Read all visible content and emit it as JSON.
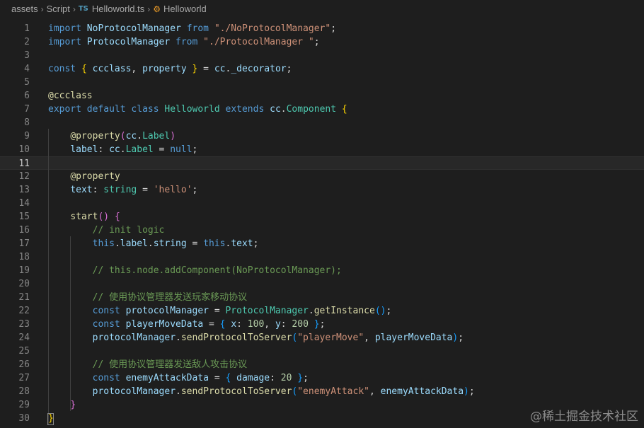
{
  "breadcrumb": {
    "folder1": "assets",
    "folder2": "Script",
    "file_icon": "TS",
    "file": "Helloworld.ts",
    "symbol": "Helloworld"
  },
  "lines": [
    {
      "n": "1",
      "t": [
        [
          "kw",
          "import"
        ],
        [
          "",
          "&nbsp;"
        ],
        [
          "var",
          "NoProtocolManager"
        ],
        [
          "",
          "&nbsp;"
        ],
        [
          "kw",
          "from"
        ],
        [
          "",
          "&nbsp;"
        ],
        [
          "str",
          "\"./NoProtocolManager\""
        ],
        [
          "",
          ";"
        ]
      ]
    },
    {
      "n": "2",
      "t": [
        [
          "kw",
          "import"
        ],
        [
          "",
          "&nbsp;"
        ],
        [
          "var",
          "ProtocolManager"
        ],
        [
          "",
          "&nbsp;"
        ],
        [
          "kw",
          "from"
        ],
        [
          "",
          "&nbsp;"
        ],
        [
          "str",
          "\"./ProtocolManager \""
        ],
        [
          "",
          ";"
        ]
      ]
    },
    {
      "n": "3",
      "t": []
    },
    {
      "n": "4",
      "t": [
        [
          "kw",
          "const"
        ],
        [
          "",
          "&nbsp;"
        ],
        [
          "br1",
          "{"
        ],
        [
          "",
          "&nbsp;"
        ],
        [
          "var",
          "ccclass"
        ],
        [
          "",
          ",&nbsp;"
        ],
        [
          "var",
          "property"
        ],
        [
          "",
          "&nbsp;"
        ],
        [
          "br1",
          "}"
        ],
        [
          "",
          "&nbsp;=&nbsp;"
        ],
        [
          "var",
          "cc"
        ],
        [
          "",
          "."
        ],
        [
          "var",
          "_decorator"
        ],
        [
          "",
          ";"
        ]
      ]
    },
    {
      "n": "5",
      "t": []
    },
    {
      "n": "6",
      "t": [
        [
          "fn",
          "@ccclass"
        ]
      ]
    },
    {
      "n": "7",
      "t": [
        [
          "kw",
          "export"
        ],
        [
          "",
          "&nbsp;"
        ],
        [
          "kw",
          "default"
        ],
        [
          "",
          "&nbsp;"
        ],
        [
          "kw",
          "class"
        ],
        [
          "",
          "&nbsp;"
        ],
        [
          "cls",
          "Helloworld"
        ],
        [
          "",
          "&nbsp;"
        ],
        [
          "kw",
          "extends"
        ],
        [
          "",
          "&nbsp;"
        ],
        [
          "var",
          "cc"
        ],
        [
          "",
          "."
        ],
        [
          "cls",
          "Component"
        ],
        [
          "",
          "&nbsp;"
        ],
        [
          "br1",
          "{"
        ]
      ]
    },
    {
      "n": "8",
      "t": []
    },
    {
      "n": "9",
      "t": [
        [
          "",
          "&nbsp;&nbsp;&nbsp;&nbsp;"
        ],
        [
          "fn",
          "@property"
        ],
        [
          "br2",
          "("
        ],
        [
          "var",
          "cc"
        ],
        [
          "",
          "."
        ],
        [
          "cls",
          "Label"
        ],
        [
          "br2",
          ")"
        ]
      ]
    },
    {
      "n": "10",
      "t": [
        [
          "",
          "&nbsp;&nbsp;&nbsp;&nbsp;"
        ],
        [
          "var",
          "label"
        ],
        [
          "",
          ":&nbsp;"
        ],
        [
          "var",
          "cc"
        ],
        [
          "",
          "."
        ],
        [
          "cls",
          "Label"
        ],
        [
          "",
          "&nbsp;=&nbsp;"
        ],
        [
          "kw",
          "null"
        ],
        [
          "",
          ";"
        ]
      ]
    },
    {
      "n": "11",
      "t": [],
      "current": true
    },
    {
      "n": "12",
      "t": [
        [
          "",
          "&nbsp;&nbsp;&nbsp;&nbsp;"
        ],
        [
          "fn",
          "@property"
        ]
      ]
    },
    {
      "n": "13",
      "t": [
        [
          "",
          "&nbsp;&nbsp;&nbsp;&nbsp;"
        ],
        [
          "var",
          "text"
        ],
        [
          "",
          ":&nbsp;"
        ],
        [
          "cls",
          "string"
        ],
        [
          "",
          "&nbsp;=&nbsp;"
        ],
        [
          "str",
          "'hello'"
        ],
        [
          "",
          ";"
        ]
      ]
    },
    {
      "n": "14",
      "t": []
    },
    {
      "n": "15",
      "t": [
        [
          "",
          "&nbsp;&nbsp;&nbsp;&nbsp;"
        ],
        [
          "fn",
          "start"
        ],
        [
          "br2",
          "()"
        ],
        [
          "",
          "&nbsp;"
        ],
        [
          "br2",
          "{"
        ]
      ]
    },
    {
      "n": "16",
      "t": [
        [
          "",
          "&nbsp;&nbsp;&nbsp;&nbsp;&nbsp;&nbsp;&nbsp;&nbsp;"
        ],
        [
          "cm",
          "// init logic"
        ]
      ]
    },
    {
      "n": "17",
      "t": [
        [
          "",
          "&nbsp;&nbsp;&nbsp;&nbsp;&nbsp;&nbsp;&nbsp;&nbsp;"
        ],
        [
          "kw",
          "this"
        ],
        [
          "",
          "."
        ],
        [
          "var",
          "label"
        ],
        [
          "",
          "."
        ],
        [
          "var",
          "string"
        ],
        [
          "",
          "&nbsp;=&nbsp;"
        ],
        [
          "kw",
          "this"
        ],
        [
          "",
          "."
        ],
        [
          "var",
          "text"
        ],
        [
          "",
          ";"
        ]
      ]
    },
    {
      "n": "18",
      "t": []
    },
    {
      "n": "19",
      "t": [
        [
          "",
          "&nbsp;&nbsp;&nbsp;&nbsp;&nbsp;&nbsp;&nbsp;&nbsp;"
        ],
        [
          "cm",
          "// this.node.addComponent(NoProtocolManager);"
        ]
      ]
    },
    {
      "n": "20",
      "t": []
    },
    {
      "n": "21",
      "t": [
        [
          "",
          "&nbsp;&nbsp;&nbsp;&nbsp;&nbsp;&nbsp;&nbsp;&nbsp;"
        ],
        [
          "cm",
          "// 使用协议管理器发送玩家移动协议"
        ]
      ]
    },
    {
      "n": "22",
      "t": [
        [
          "",
          "&nbsp;&nbsp;&nbsp;&nbsp;&nbsp;&nbsp;&nbsp;&nbsp;"
        ],
        [
          "kw",
          "const"
        ],
        [
          "",
          "&nbsp;"
        ],
        [
          "var",
          "protocolManager"
        ],
        [
          "",
          "&nbsp;=&nbsp;"
        ],
        [
          "cls",
          "ProtocolManager"
        ],
        [
          "",
          "."
        ],
        [
          "fn",
          "getInstance"
        ],
        [
          "br3",
          "()"
        ],
        [
          "",
          ";"
        ]
      ]
    },
    {
      "n": "23",
      "t": [
        [
          "",
          "&nbsp;&nbsp;&nbsp;&nbsp;&nbsp;&nbsp;&nbsp;&nbsp;"
        ],
        [
          "kw",
          "const"
        ],
        [
          "",
          "&nbsp;"
        ],
        [
          "var",
          "playerMoveData"
        ],
        [
          "",
          "&nbsp;=&nbsp;"
        ],
        [
          "br3",
          "{"
        ],
        [
          "",
          "&nbsp;"
        ],
        [
          "var",
          "x"
        ],
        [
          "",
          ":&nbsp;"
        ],
        [
          "num",
          "100"
        ],
        [
          "",
          ",&nbsp;"
        ],
        [
          "var",
          "y"
        ],
        [
          "",
          ":&nbsp;"
        ],
        [
          "num",
          "200"
        ],
        [
          "",
          "&nbsp;"
        ],
        [
          "br3",
          "}"
        ],
        [
          "",
          ";"
        ]
      ]
    },
    {
      "n": "24",
      "t": [
        [
          "",
          "&nbsp;&nbsp;&nbsp;&nbsp;&nbsp;&nbsp;&nbsp;&nbsp;"
        ],
        [
          "var",
          "protocolManager"
        ],
        [
          "",
          "."
        ],
        [
          "fn",
          "sendProtocolToServer"
        ],
        [
          "br3",
          "("
        ],
        [
          "str",
          "\"playerMove\""
        ],
        [
          "",
          ",&nbsp;"
        ],
        [
          "var",
          "playerMoveData"
        ],
        [
          "br3",
          ")"
        ],
        [
          "",
          ";"
        ]
      ]
    },
    {
      "n": "25",
      "t": []
    },
    {
      "n": "26",
      "t": [
        [
          "",
          "&nbsp;&nbsp;&nbsp;&nbsp;&nbsp;&nbsp;&nbsp;&nbsp;"
        ],
        [
          "cm",
          "// 使用协议管理器发送敌人攻击协议"
        ]
      ]
    },
    {
      "n": "27",
      "t": [
        [
          "",
          "&nbsp;&nbsp;&nbsp;&nbsp;&nbsp;&nbsp;&nbsp;&nbsp;"
        ],
        [
          "kw",
          "const"
        ],
        [
          "",
          "&nbsp;"
        ],
        [
          "var",
          "enemyAttackData"
        ],
        [
          "",
          "&nbsp;=&nbsp;"
        ],
        [
          "br3",
          "{"
        ],
        [
          "",
          "&nbsp;"
        ],
        [
          "var",
          "damage"
        ],
        [
          "",
          ":&nbsp;"
        ],
        [
          "num",
          "20"
        ],
        [
          "",
          "&nbsp;"
        ],
        [
          "br3",
          "}"
        ],
        [
          "",
          ";"
        ]
      ]
    },
    {
      "n": "28",
      "t": [
        [
          "",
          "&nbsp;&nbsp;&nbsp;&nbsp;&nbsp;&nbsp;&nbsp;&nbsp;"
        ],
        [
          "var",
          "protocolManager"
        ],
        [
          "",
          "."
        ],
        [
          "fn",
          "sendProtocolToServer"
        ],
        [
          "br3",
          "("
        ],
        [
          "str",
          "\"enemyAttack\""
        ],
        [
          "",
          ",&nbsp;"
        ],
        [
          "var",
          "enemyAttackData"
        ],
        [
          "br3",
          ")"
        ],
        [
          "",
          ";"
        ]
      ]
    },
    {
      "n": "29",
      "t": [
        [
          "",
          "&nbsp;&nbsp;&nbsp;&nbsp;"
        ],
        [
          "br2",
          "}"
        ]
      ]
    },
    {
      "n": "30",
      "t": [
        [
          "br1",
          "}"
        ]
      ]
    }
  ],
  "watermark": "@稀土掘金技术社区"
}
